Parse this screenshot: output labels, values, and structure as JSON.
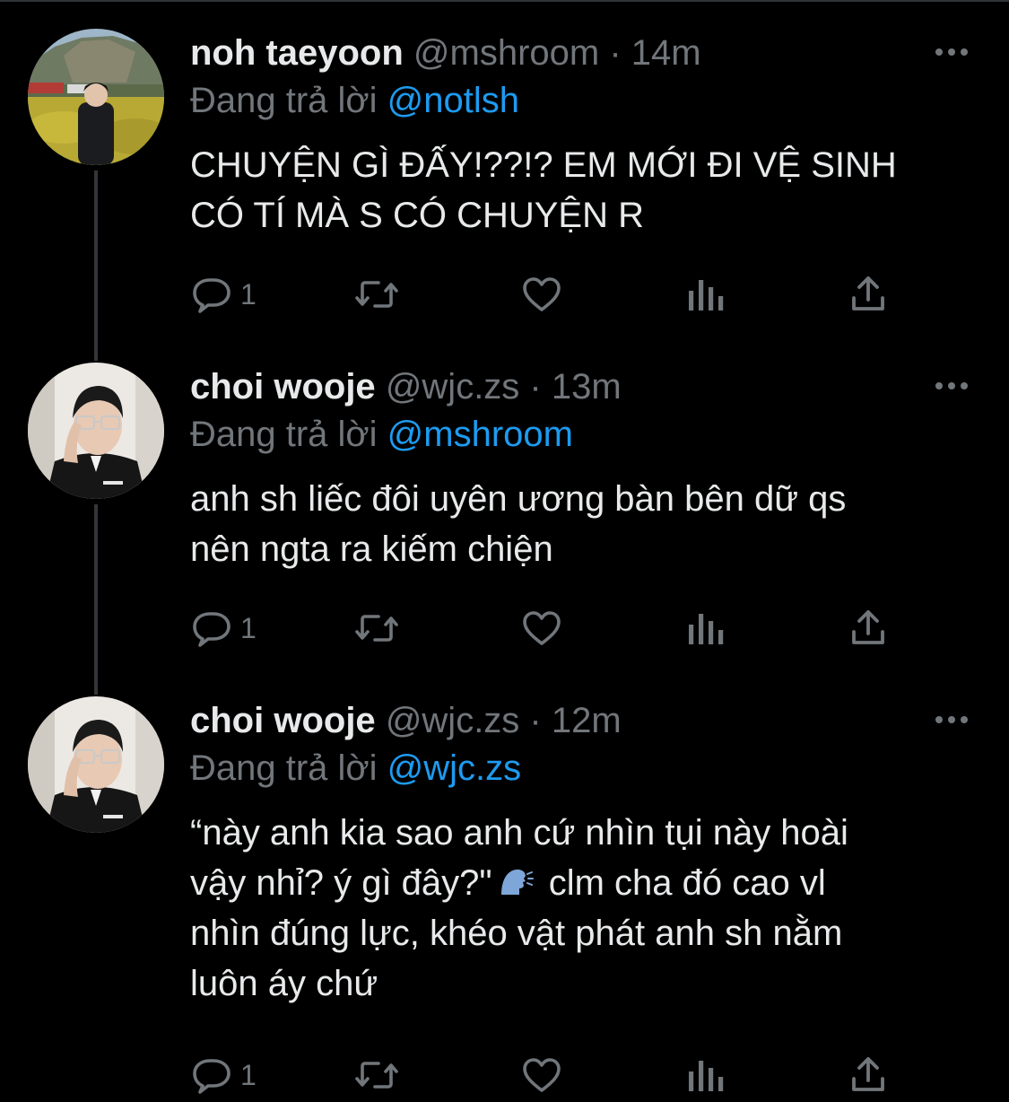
{
  "tweets": [
    {
      "display_name": "noh taeyoon",
      "handle": "@mshroom",
      "separator": " · ",
      "time": "14m",
      "reply_prefix": "Đang trả lời ",
      "reply_to": "@notlsh",
      "text": "CHUYỆN GÌ ĐẤY!??!? EM MỚI ĐI VỆ SINH\nCÓ TÍ MÀ S CÓ CHUYỆN R",
      "reply_count": "1"
    },
    {
      "display_name": "choi wooje",
      "handle": "@wjc.zs",
      "separator": " · ",
      "time": "13m",
      "reply_prefix": "Đang trả lời ",
      "reply_to": "@mshroom",
      "text": "anh sh liếc đôi uyên ương bàn bên dữ qs\nnên ngta ra kiếm chiện",
      "reply_count": "1"
    },
    {
      "display_name": "choi wooje",
      "handle": "@wjc.zs",
      "separator": " · ",
      "time": "12m",
      "reply_prefix": "Đang trả lời ",
      "reply_to": "@wjc.zs",
      "text_part1": "“này anh kia sao anh cứ nhìn tụi này hoài\nvậy nhỉ? ý gì đây?\"",
      "text_emoji": "speaking-head-emoji",
      "text_part2": " clm cha đó cao vl\nnhìn đúng lực, khéo vật phát anh sh nằm\nluôn áy chứ",
      "reply_count": "1"
    }
  ],
  "colors": {
    "background": "#000000",
    "text": "#e7e9ea",
    "secondary": "#71767b",
    "link": "#1d9bf0",
    "thread_line": "#333639"
  },
  "icons": [
    "reply-icon",
    "retweet-icon",
    "like-icon",
    "analytics-icon",
    "share-icon",
    "more-icon"
  ]
}
